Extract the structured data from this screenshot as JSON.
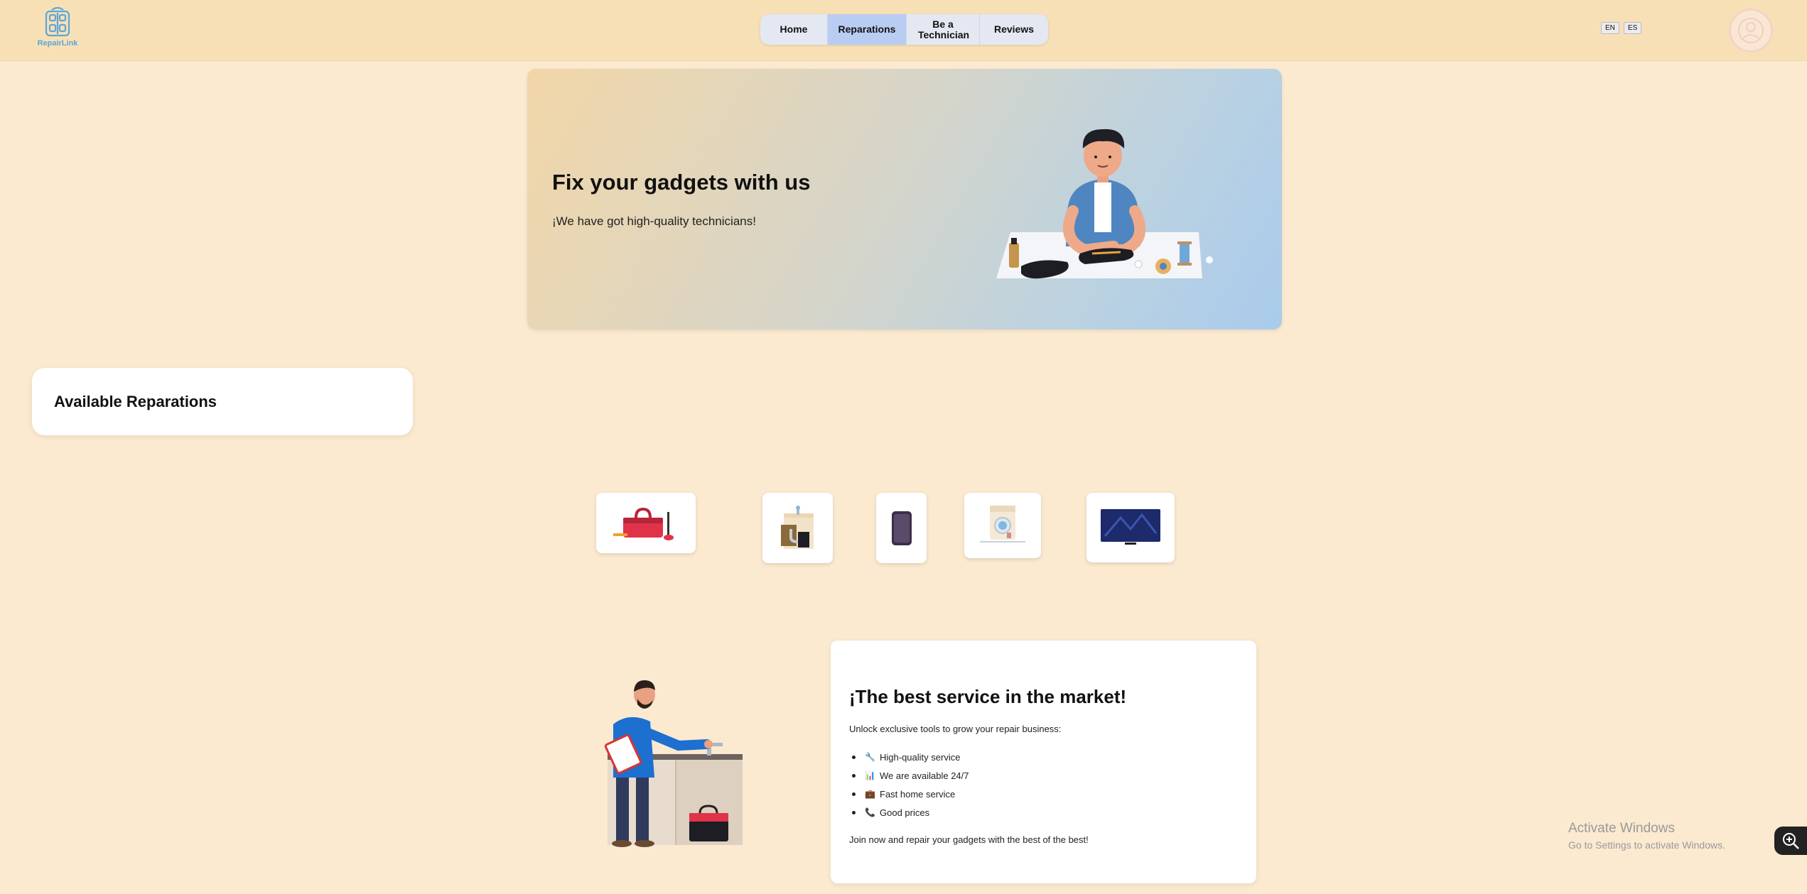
{
  "brand": {
    "logo_text": "RepairLink",
    "accent": "#5ea6d6"
  },
  "nav": {
    "home": "Home",
    "reparations": "Reparations",
    "technician": "Be a Technician",
    "reviews": "Reviews",
    "active": "Reparations"
  },
  "lang": {
    "en": "EN",
    "es": "ES"
  },
  "hero": {
    "title": "Fix your gadgets with us",
    "subtitle": "¡We have got high-quality technicians!"
  },
  "available": {
    "title": "Available Reparations"
  },
  "categories": [
    {
      "icon": "toolbox-icon"
    },
    {
      "icon": "sink-plumbing-icon"
    },
    {
      "icon": "smartphone-icon"
    },
    {
      "icon": "washing-machine-icon"
    },
    {
      "icon": "television-icon"
    }
  ],
  "service": {
    "title": "¡The best service in the market!",
    "intro": "Unlock exclusive tools to grow your repair business:",
    "items": [
      {
        "icon": "🔧",
        "label": "High-quality service"
      },
      {
        "icon": "📊",
        "label": "We are available 24/7"
      },
      {
        "icon": "💼",
        "label": "Fast home service"
      },
      {
        "icon": "📞",
        "label": "Good prices"
      }
    ],
    "join": "Join now and repair your gadgets with the best of the best!"
  },
  "watermark": {
    "title": "Activate Windows",
    "subtitle": "Go to Settings to activate Windows."
  }
}
